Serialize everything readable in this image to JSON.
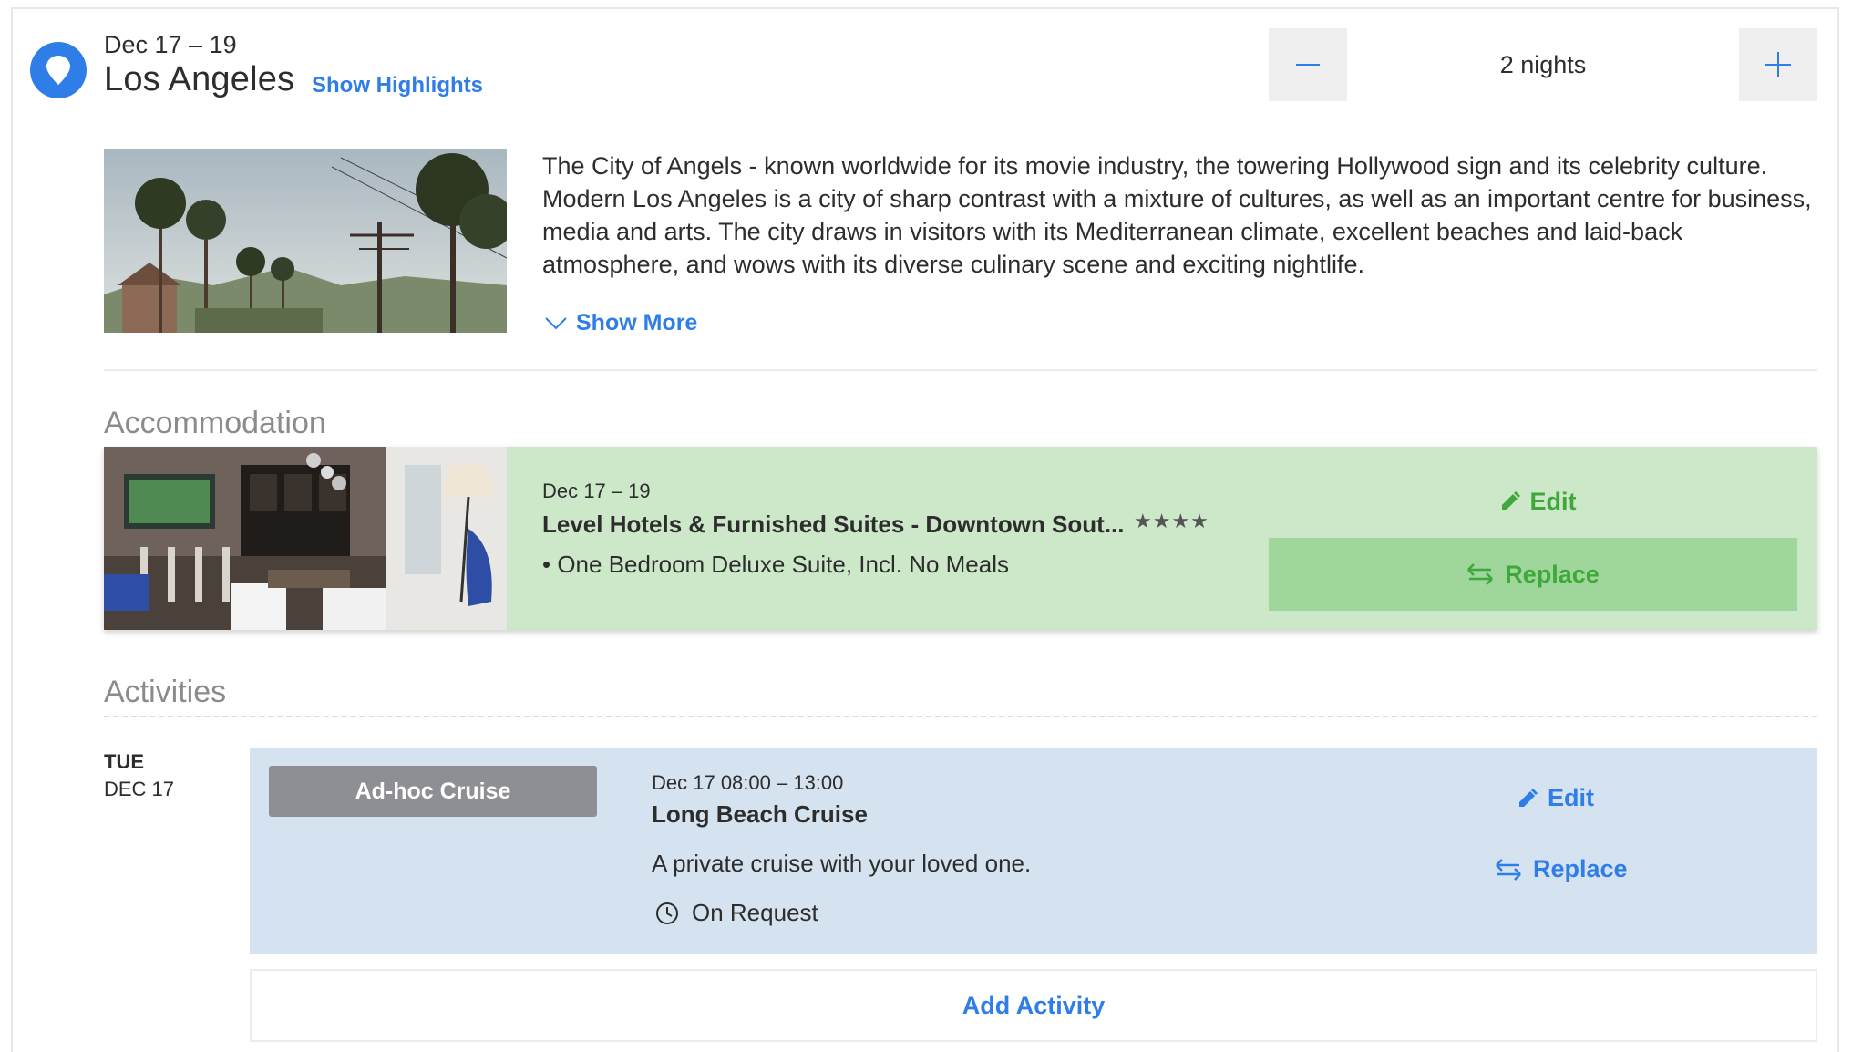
{
  "destination": {
    "dates": "Dec 17 – 19",
    "city": "Los Angeles",
    "highlights_link": "Show Highlights",
    "nights_value": "2 nights",
    "description": "The City of Angels - known worldwide for its movie industry, the towering Hollywood sign and its celebrity culture. Modern Los Angeles is a city of sharp contrast with a mixture of cultures, as well as an important centre for business, media and arts. The city draws in visitors with its Mediterranean climate, excellent beaches and laid-back atmosphere, and wows with its diverse culinary scene and exciting nightlife.",
    "show_more": "Show More"
  },
  "accommodation": {
    "section_title": "Accommodation",
    "dates": "Dec 17 – 19",
    "hotel_name": "Level Hotels & Furnished Suites - Downtown Sout...",
    "stars": "★★★★",
    "room": "• One Bedroom Deluxe Suite, Incl. No Meals",
    "edit_label": "Edit",
    "replace_label": "Replace"
  },
  "activities": {
    "section_title": "Activities",
    "day_of_week": "TUE",
    "day_date": "DEC 17",
    "items": [
      {
        "badge": "Ad-hoc Cruise",
        "time": "Dec 17 08:00 – 13:00",
        "name": "Long Beach Cruise",
        "description": "A private cruise with your loved one.",
        "status": "On Request",
        "edit_label": "Edit",
        "replace_label": "Replace"
      }
    ],
    "add_label": "Add Activity"
  },
  "colors": {
    "accent_blue": "#2f7ee8",
    "accommodation_bg": "#cce8c9",
    "accommodation_accent": "#3fa83a",
    "activity_bg": "#d5e3f0",
    "badge_bg": "#8e8e95"
  },
  "icons": [
    "location-pin-icon",
    "minus-icon",
    "plus-icon",
    "chevron-down-icon",
    "pencil-icon",
    "swap-arrows-icon",
    "clock-icon"
  ]
}
